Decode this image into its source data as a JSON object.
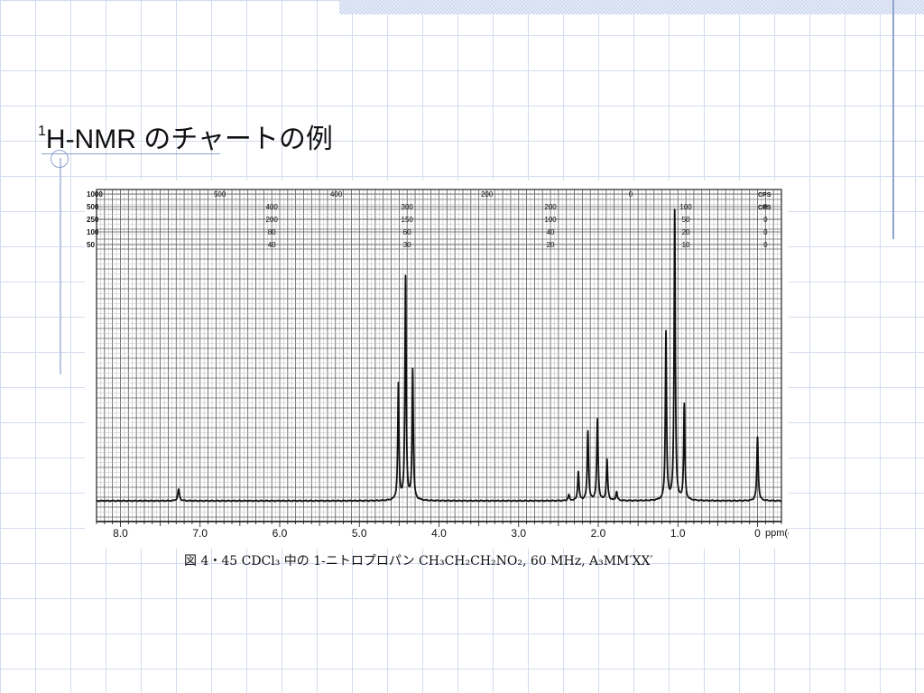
{
  "slide": {
    "title_sup": "1",
    "title_main": "H-NMR のチャートの例"
  },
  "chart_data": {
    "type": "line",
    "caption": "図 4・45   CDCl₃ 中の 1-ニトロプロパン CH₃CH₂CH₂NO₂,  60 MHz,  A₃MM′XX′",
    "x_ticks": [
      "8.0",
      "7.0",
      "6.0",
      "5.0",
      "4.0",
      "3.0",
      "2.0",
      "1.0",
      "0"
    ],
    "x_axis_label": "ppm(δ)",
    "xlim": [
      8.3,
      -0.3
    ],
    "x_reversed": true,
    "ylim": [
      0,
      1
    ],
    "grid": true,
    "sweep_width_labels": [
      "1000",
      "500",
      "250",
      "100",
      "50"
    ],
    "scale_rows": [
      {
        "tag": "CPS",
        "ticks": [
          "500",
          "400",
          "200",
          "0"
        ]
      },
      {
        "tag": "CPS",
        "ticks": [
          "400",
          "300",
          "200",
          "100",
          "0"
        ]
      },
      {
        "tag": "",
        "ticks": [
          "200",
          "150",
          "100",
          "50",
          "0"
        ]
      },
      {
        "tag": "",
        "ticks": [
          "80",
          "60",
          "40",
          "20",
          "0"
        ]
      },
      {
        "tag": "",
        "ticks": [
          "40",
          "30",
          "20",
          "10",
          "0"
        ]
      }
    ],
    "peaks": [
      {
        "x": 7.27,
        "y": 0.04,
        "w": 0.012
      },
      {
        "x": 4.51,
        "y": 0.4,
        "w": 0.009
      },
      {
        "x": 4.42,
        "y": 0.77,
        "w": 0.009
      },
      {
        "x": 4.33,
        "y": 0.45,
        "w": 0.009
      },
      {
        "x": 2.25,
        "y": 0.1,
        "w": 0.01
      },
      {
        "x": 2.13,
        "y": 0.24,
        "w": 0.01
      },
      {
        "x": 2.01,
        "y": 0.28,
        "w": 0.01
      },
      {
        "x": 1.89,
        "y": 0.14,
        "w": 0.01
      },
      {
        "x": 1.77,
        "y": 0.03,
        "w": 0.01
      },
      {
        "x": 2.37,
        "y": 0.02,
        "w": 0.01
      },
      {
        "x": 1.15,
        "y": 0.58,
        "w": 0.009
      },
      {
        "x": 1.04,
        "y": 1.0,
        "w": 0.009
      },
      {
        "x": 0.92,
        "y": 0.33,
        "w": 0.009
      },
      {
        "x": 0.0,
        "y": 0.22,
        "w": 0.01
      }
    ]
  }
}
